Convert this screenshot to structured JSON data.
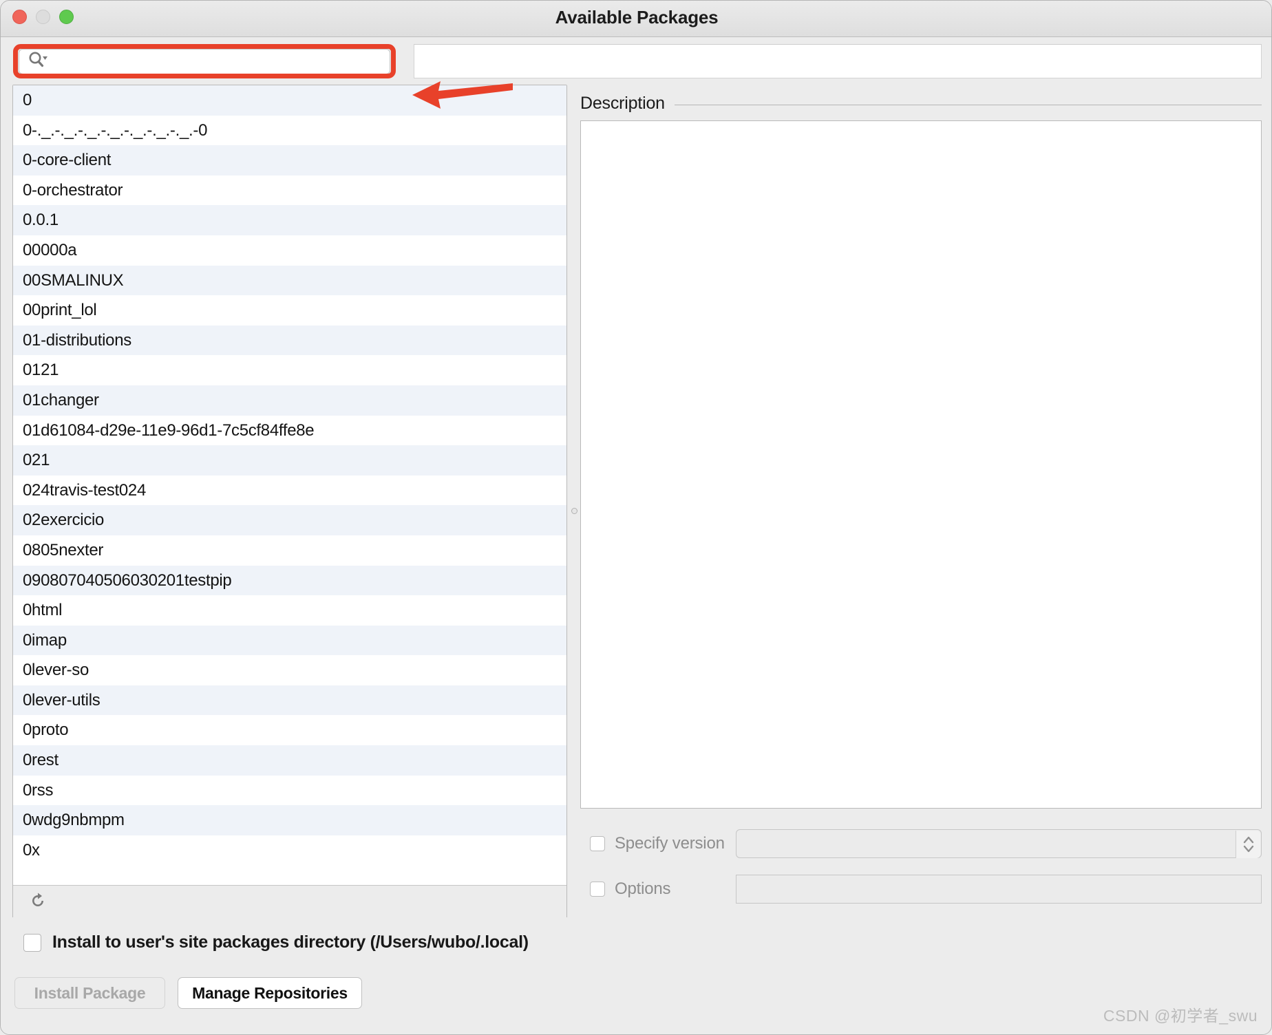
{
  "window": {
    "title": "Available Packages",
    "traffic_lights": [
      "close-button",
      "minimize-button",
      "maximize-button"
    ]
  },
  "search": {
    "value": "",
    "placeholder": "",
    "icon": "search-icon-with-dropdown",
    "annotation": "red-arrow-pointing-to-search-field",
    "highlight_color": "#e8412a"
  },
  "package_list": {
    "items": [
      "0",
      "0-._.-._.-._.-._.-._.-._.-._.-0",
      "0-core-client",
      "0-orchestrator",
      "0.0.1",
      "00000a",
      "00SMALINUX",
      "00print_lol",
      "01-distributions",
      "0121",
      "01changer",
      "01d61084-d29e-11e9-96d1-7c5cf84ffe8e",
      "021",
      "024travis-test024",
      "02exercicio",
      "0805nexter",
      "090807040506030201testpip",
      "0html",
      "0imap",
      "0lever-so",
      "0lever-utils",
      "0proto",
      "0rest",
      "0rss",
      "0wdg9nbmpm",
      "0x"
    ],
    "refresh_icon": "refresh-icon"
  },
  "description": {
    "label": "Description",
    "content": ""
  },
  "specify_version": {
    "label": "Specify version",
    "checked": false,
    "value": "",
    "stepper_icon": "up-down-stepper-icon"
  },
  "options": {
    "label": "Options",
    "checked": false,
    "value": ""
  },
  "footer": {
    "user_dir_label": "Install to user's site packages directory (/Users/wubo/.local)",
    "user_dir_checked": false,
    "install_button": "Install Package",
    "manage_button": "Manage Repositories"
  },
  "watermark": "CSDN @初学者_swu"
}
